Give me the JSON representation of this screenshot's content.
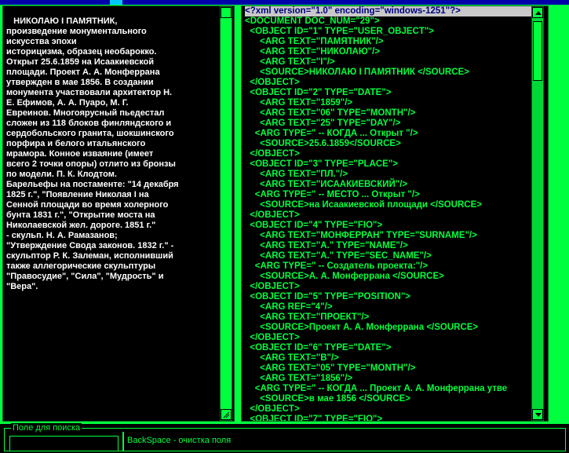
{
  "left_panel": {
    "text": "   НИКОЛАЮ I ПАМЯТНИК,\nпроизведение монументального\nискусства эпохи\nисторицизма, образец необарокко.\nОткрыт 25.6.1859 на Исаакиевской\nплощади. Проект А. А. Монферрана\nутвержден в мае 1856. В создании\nмонумента участвовали архитектор Н.\nЕ. Ефимов, А. А. Пуаро, М. Г.\nЕвреинов. Многоярусный пьедестал\nсложен из 118 блоков финляндского и\nсердобольского гранита, шокшинского\nпорфира и белого итальянского\nмрамора. Конное изваяние (имеет\nвсего 2 точки опоры) отлито из бронзы\nпо модели. П. К. Клодтом.\nБарельефы на постаменте: \"14 декабря\n1825 г.\", \"Появление Николая I на\nСенной площади во время холерного\nбунта 1831 г.\", \"Открытие моста на\nНиколаевской жел. дороге. 1851 г.\"\n- скульп. Н. А. Рамазанов;\n\"Утверждение Свода законов. 1832 г.\" -\nскульптор Р. К. Залеман, исполнивший\nтакже аллегорические скульптуры\n\"Правосудие\", \"Сила\", \"Мудрость\" и\n\"Вера\"."
  },
  "xml_lines": [
    "<?xml version=\"1.0\" encoding=\"windows-1251\"?>",
    "<DOCUMENT DOC_NUM=\"29\">",
    "  <OBJECT ID=\"1\" TYPE=\"USER_OBJECT\">",
    "      <ARG TEXT=\"ПАМЯТНИК\"/>",
    "      <ARG TEXT=\"НИКОЛАЮ\"/>",
    "      <ARG TEXT=\"I\"/>",
    "      <SOURCE>НИКОЛАЮ I ПАМЯТНИК </SOURCE>",
    "  </OBJECT>",
    "  <OBJECT ID=\"2\" TYPE=\"DATE\">",
    "      <ARG TEXT=\"1859\"/>",
    "      <ARG TEXT=\"06\" TYPE=\"MONTH\"/>",
    "      <ARG TEXT=\"25\" TYPE=\"DAY\"/>",
    "    <ARG TYPE=\" -- КОГДА ... Открыт \"/>",
    "      <SOURCE>25.6.1859</SOURCE>",
    "  </OBJECT>",
    "  <OBJECT ID=\"3\" TYPE=\"PLACE\">",
    "      <ARG TEXT=\"ПЛ.\"/>",
    "      <ARG TEXT=\"ИСААКИЕВСКИЙ\"/>",
    "    <ARG TYPE=\" -- МЕСТО ... Открыт \"/>",
    "      <SOURCE>на Исаакиевской площади </SOURCE>",
    "  </OBJECT>",
    "  <OBJECT ID=\"4\" TYPE=\"FIO\">",
    "      <ARG TEXT=\"МОНФЕРРАН\" TYPE=\"SURNAME\"/>",
    "      <ARG TEXT=\"А.\" TYPE=\"NAME\"/>",
    "      <ARG TEXT=\"А.\" TYPE=\"SEC_NAME\"/>",
    "    <ARG TYPE=\" -- Создатель проекта:\"/>",
    "      <SOURCE>А. А. Монферрана </SOURCE>",
    "  </OBJECT>",
    "  <OBJECT ID=\"5\" TYPE=\"POSITION\">",
    "      <ARG REF=\"4\"/>",
    "      <ARG TEXT=\"ПРОЕКТ\"/>",
    "      <SOURCE>Проект А. А. Монферрана </SOURCE>",
    "  </OBJECT>",
    "  <OBJECT ID=\"6\" TYPE=\"DATE\">",
    "      <ARG TEXT=\"В\"/>",
    "      <ARG TEXT=\"05\" TYPE=\"MONTH\"/>",
    "      <ARG TEXT=\"1856\"/>",
    "    <ARG TYPE=\" -- КОГДА ... Проект А. А. Монферрана утве",
    "      <SOURCE>в мае 1856 </SOURCE>",
    "  </OBJECT>",
    "  <OBJECT ID=\"7\" TYPE=\"FIO\">"
  ],
  "search": {
    "legend": "Поле для поиска",
    "value": "",
    "hint": "BackSpace - очистка поля"
  },
  "colors": {
    "accent": "#00ff3f",
    "panel_bg": "#000000",
    "text_left": "#ffffff",
    "highlight_bg": "#c8c8c8",
    "highlight_fg": "#000080"
  }
}
